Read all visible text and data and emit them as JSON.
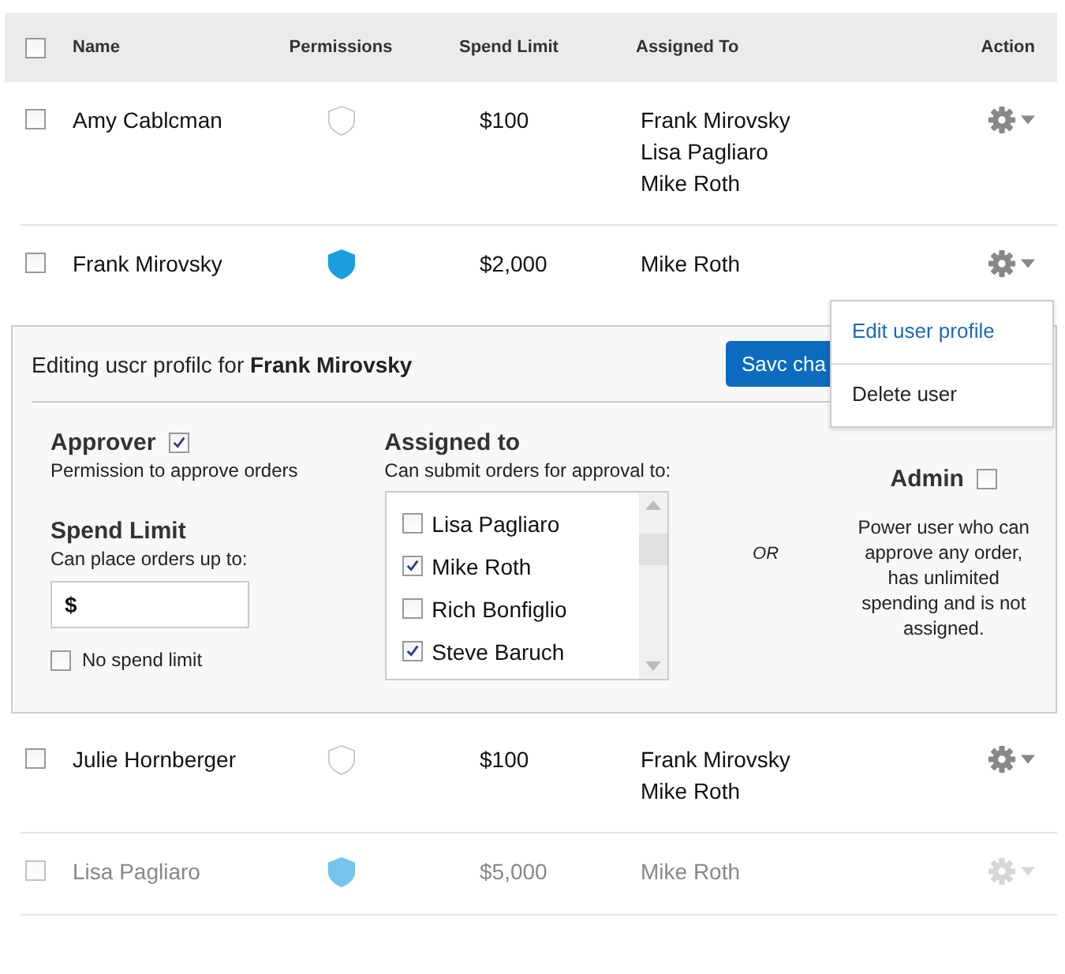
{
  "table": {
    "columns": [
      "Name",
      "Permissions",
      "Spend Limit",
      "Assigned To",
      "Action"
    ],
    "header_checked": false,
    "rows": [
      {
        "checked": false,
        "name": "Amy Cablcman",
        "approver": false,
        "spend": "$100",
        "assigned": [
          "Frank Mirovsky",
          "Lisa Pagliaro",
          "Mike Roth"
        ],
        "disabled": false,
        "editing": false
      },
      {
        "checked": false,
        "name": "Frank Mirovsky",
        "approver": true,
        "spend": "$2,000",
        "assigned": [
          "Mike Roth"
        ],
        "disabled": false,
        "editing": true
      },
      {
        "checked": false,
        "name": "Julie Hornberger",
        "approver": false,
        "spend": "$100",
        "assigned": [
          "Frank Mirovsky",
          "Mike Roth"
        ],
        "disabled": false,
        "editing": false
      },
      {
        "checked": false,
        "name": "Lisa Pagliaro",
        "approver": true,
        "spend": "$5,000",
        "assigned": [
          "Mike Roth"
        ],
        "disabled": true,
        "editing": false
      }
    ]
  },
  "edit_panel": {
    "title": "Editing uscr profilc for **Frank Mirovsky**",
    "save_button": "Savc cha",
    "approver": {
      "label": "Approver",
      "checked": true,
      "description": "Permission to approve orders"
    },
    "spend_limit": {
      "label": "Spend Limit",
      "description": "Can place orders up to:",
      "prefix": "$",
      "no_limit_label": "No spend limit",
      "no_limit_checked": false
    },
    "assigned_to": {
      "label": "Assigned to",
      "description": "Can submit orders for approval to:",
      "items": [
        {
          "name": "Lisa Pagliaro",
          "checked": false
        },
        {
          "name": "Mike Roth",
          "checked": true
        },
        {
          "name": "Rich Bonfiglio",
          "checked": false
        },
        {
          "name": "Steve Baruch",
          "checked": true
        }
      ]
    },
    "or_label": "OR",
    "admin": {
      "label": "Admin",
      "checked": false,
      "description": "Power user who can approve any order, has unlimited spending and is not assigned."
    }
  },
  "action_menu": {
    "items": [
      "Edit user profile",
      "Delete user"
    ]
  }
}
